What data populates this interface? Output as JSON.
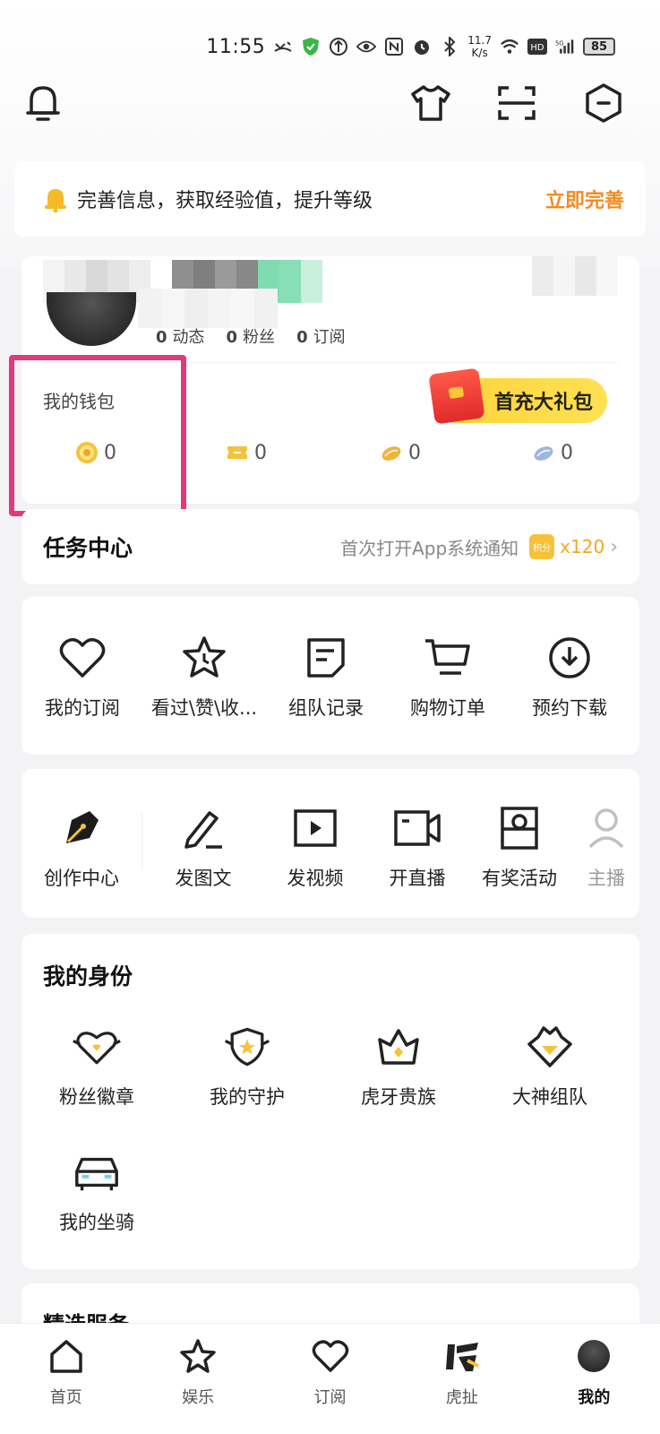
{
  "status_bar": {
    "time": "11:55",
    "net_speed_value": "11.7",
    "net_speed_unit": "K/s",
    "battery": "85"
  },
  "top_actions": {
    "icons": [
      "bell-icon",
      "tshirt-icon",
      "scan-icon",
      "settings-hex-icon"
    ]
  },
  "notice": {
    "text": "完善信息，获取经验值，提升等级",
    "cta": "立即完善"
  },
  "profile": {
    "stats": [
      {
        "value": "0",
        "label": "动态"
      },
      {
        "value": "0",
        "label": "粉丝"
      },
      {
        "value": "0",
        "label": "订阅"
      }
    ]
  },
  "wallet": {
    "title": "我的钱包",
    "gift_label": "首充大礼包",
    "items": [
      {
        "value": "0",
        "color": "#f5b829"
      },
      {
        "value": "0",
        "color": "#f5c23a"
      },
      {
        "value": "0",
        "color": "#f0b43a"
      },
      {
        "value": "0",
        "color": "#9fb7e0"
      }
    ]
  },
  "task_center": {
    "title": "任务中心",
    "hint": "首次打开App系统通知",
    "badge": "积分",
    "reward": "x120"
  },
  "quick": {
    "items": [
      {
        "label": "我的订阅"
      },
      {
        "label": "看过\\赞\\收..."
      },
      {
        "label": "组队记录"
      },
      {
        "label": "购物订单"
      },
      {
        "label": "预约下载"
      }
    ]
  },
  "creator": {
    "items": [
      {
        "label": "创作中心"
      },
      {
        "label": "发图文"
      },
      {
        "label": "发视频"
      },
      {
        "label": "开直播"
      },
      {
        "label": "有奖活动"
      },
      {
        "label": "主播"
      }
    ]
  },
  "identity": {
    "title": "我的身份",
    "items": [
      {
        "label": "粉丝徽章"
      },
      {
        "label": "我的守护"
      },
      {
        "label": "虎牙贵族"
      },
      {
        "label": "大神组队"
      },
      {
        "label": "我的坐骑"
      }
    ]
  },
  "services": {
    "title": "精选服务"
  },
  "nav": {
    "items": [
      {
        "label": "首页"
      },
      {
        "label": "娱乐"
      },
      {
        "label": "订阅"
      },
      {
        "label": "虎扯"
      },
      {
        "label": "我的"
      }
    ]
  }
}
